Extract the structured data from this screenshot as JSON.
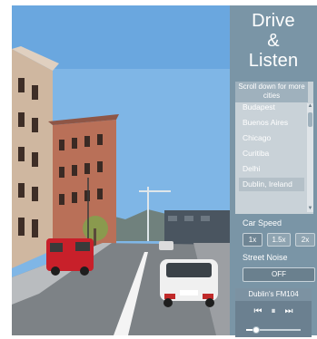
{
  "app": {
    "title_lines": [
      "Drive",
      "&",
      "Listen"
    ]
  },
  "city_list": {
    "scroll_hint": "Scroll down for more cities",
    "items": [
      {
        "label": "Budapest"
      },
      {
        "label": "Buenos Aires"
      },
      {
        "label": "Chicago"
      },
      {
        "label": "Curitiba"
      },
      {
        "label": "Delhi"
      },
      {
        "label": "Dublin, Ireland",
        "selected": true
      }
    ]
  },
  "controls": {
    "car_speed_label": "Car Speed",
    "speeds": [
      "1x",
      "1.5x",
      "2x"
    ],
    "active_speed": "1x",
    "street_noise_label": "Street Noise",
    "street_noise_toggle": "OFF"
  },
  "player": {
    "station": "Dublin's FM104",
    "progress_fraction": 0.18
  },
  "colors": {
    "panel": "#7a95a6",
    "sky": "#7fb6e6",
    "accent": "#6b8090"
  },
  "icons": {
    "prev": "skip-previous-icon",
    "pause": "pause-icon",
    "next": "skip-next-icon"
  }
}
